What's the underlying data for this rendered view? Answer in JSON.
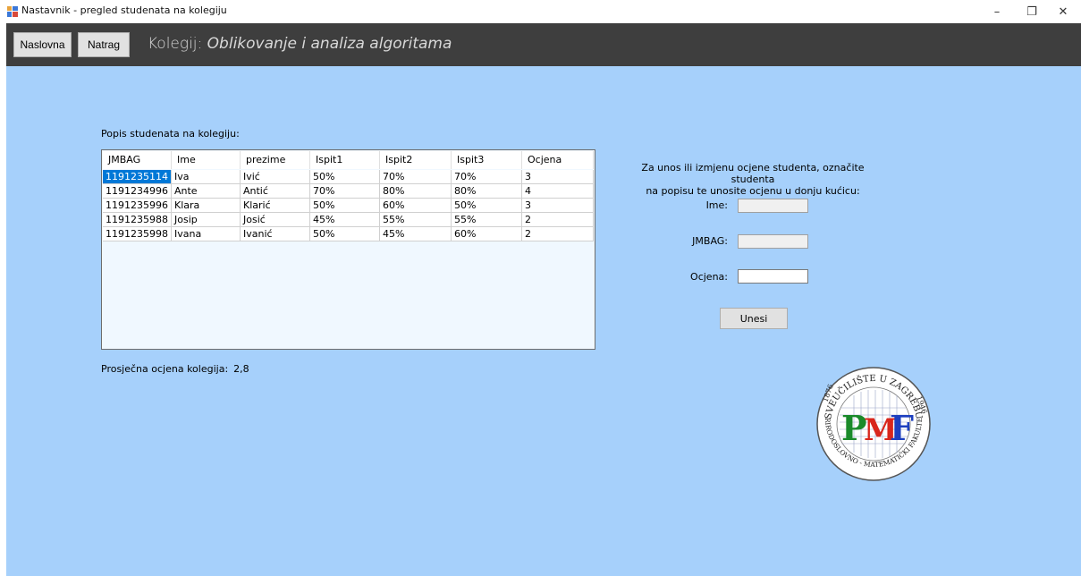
{
  "window": {
    "title": "Nastavnik - pregled studenata na kolegiju",
    "minimize_glyph": "–",
    "maximize_glyph": "❐",
    "close_glyph": "✕"
  },
  "header": {
    "home_button": "Naslovna",
    "back_button": "Natrag",
    "title_prefix": "Kolegij:",
    "course_name": "Oblikovanje i analiza algoritama"
  },
  "students": {
    "label": "Popis studenata na kolegiju:",
    "columns": [
      "JMBAG",
      "Ime",
      "prezime",
      "Ispit1",
      "Ispit2",
      "Ispit3",
      "Ocjena"
    ],
    "rows": [
      [
        "1191235114",
        "Iva",
        "Ivić",
        "50%",
        "70%",
        "70%",
        "3"
      ],
      [
        "1191234996",
        "Ante",
        "Antić",
        "70%",
        "80%",
        "80%",
        "4"
      ],
      [
        "1191235996",
        "Klara",
        "Klarić",
        "50%",
        "60%",
        "50%",
        "3"
      ],
      [
        "1191235988",
        "Josip",
        "Josić",
        "45%",
        "55%",
        "55%",
        "2"
      ],
      [
        "1191235998",
        "Ivana",
        "Ivanić",
        "50%",
        "45%",
        "60%",
        "2"
      ]
    ]
  },
  "average": {
    "label": "Prosječna ocjena kolegija:",
    "value": "2,8"
  },
  "form": {
    "instruction_line1": "Za unos ili izmjenu ocjene studenta, označite studenta",
    "instruction_line2": "na popisu te unosite ocjenu u donju kućicu:",
    "ime_label": "Ime:",
    "jmbag_label": "JMBAG:",
    "ocjena_label": "Ocjena:",
    "ime_value": "",
    "jmbag_value": "",
    "ocjena_value": "",
    "submit_label": "Unesi"
  },
  "logo": {
    "arc_top": "SVEUČILIŠTE U ZAGREBU",
    "arc_bottom": "PRIRODOSLOVNO - MATEMATIČKI FAKULTET",
    "year_left": "1876",
    "year_right": "1946",
    "letter_p": "P",
    "letter_m": "M",
    "letter_f": "F"
  },
  "colors": {
    "background": "#a6d0fb",
    "header": "#3e3e3e",
    "selection": "#0078d7",
    "logo_p": "#1a8a2a",
    "logo_m": "#d9261c",
    "logo_f": "#1d3fbf"
  }
}
